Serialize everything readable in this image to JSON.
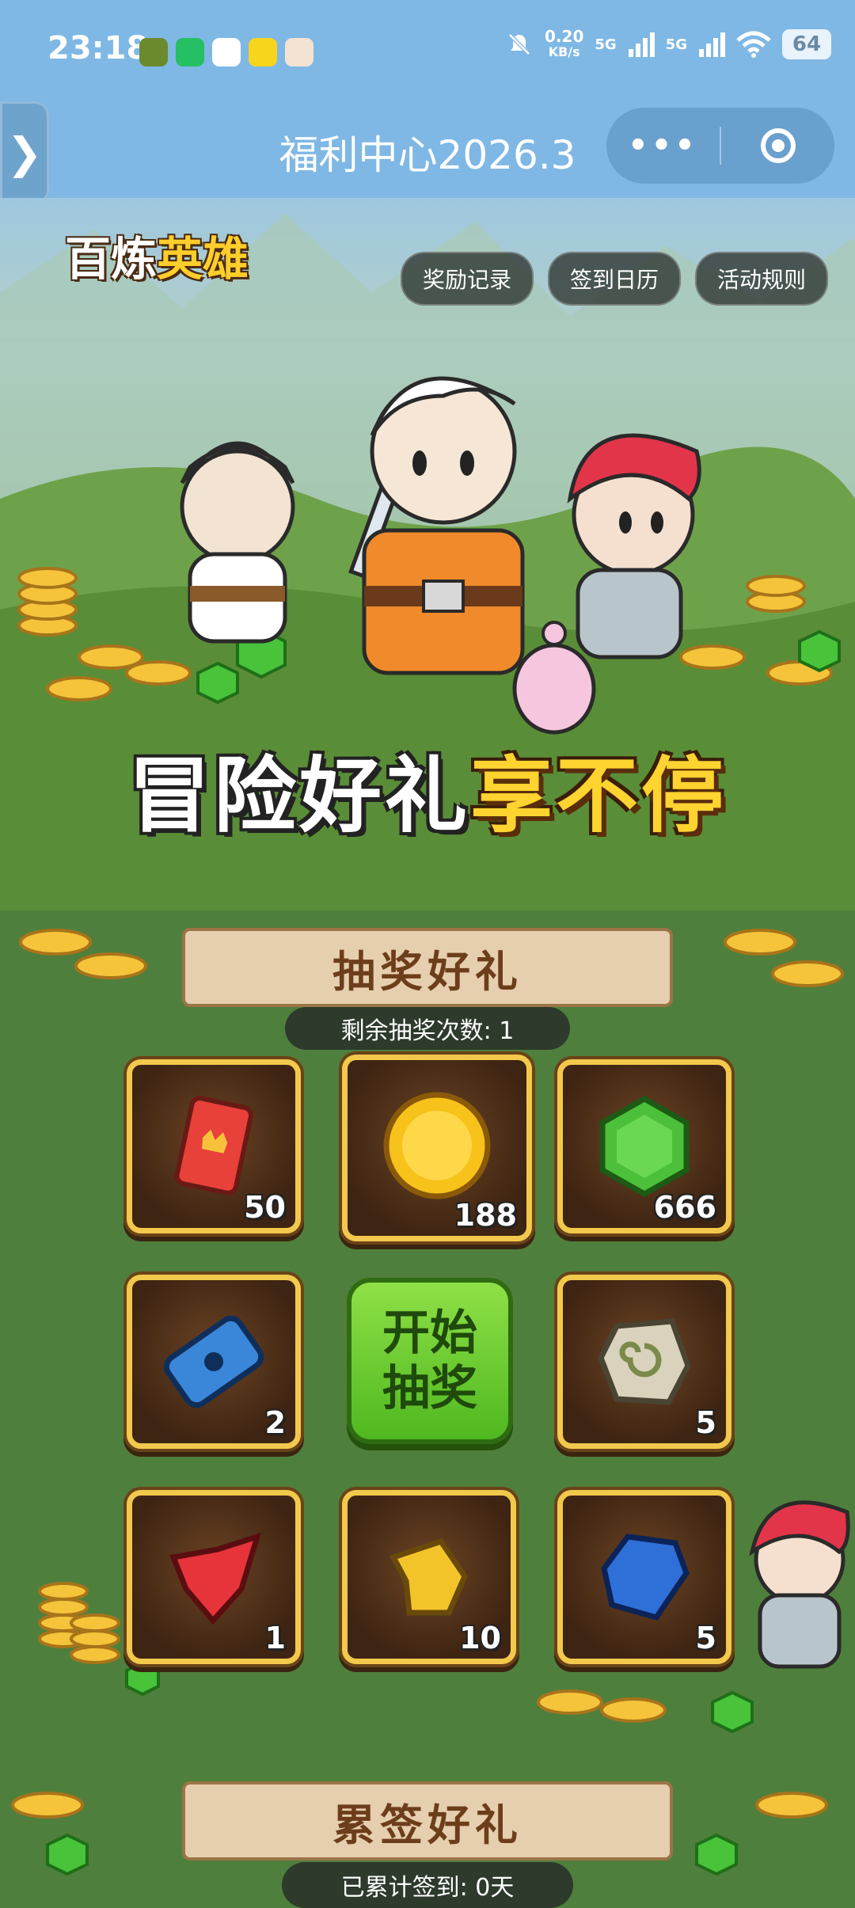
{
  "status_bar": {
    "time": "23:18",
    "net_speed_value": "0.20",
    "net_speed_unit": "KB/s",
    "signal1": "5G",
    "signal2": "5G",
    "battery": "64"
  },
  "title_bar": {
    "title": "福利中心2026.3",
    "more": "•••"
  },
  "hero": {
    "logo_part1": "百炼",
    "logo_part2": "英雄",
    "links": [
      "奖励记录",
      "签到日历",
      "活动规则"
    ],
    "slogan_white": "冒险好礼",
    "slogan_yellow": "享不停"
  },
  "lottery": {
    "heading": "抽奖好礼",
    "remaining": "剩余抽奖次数: 1",
    "start_line1": "开始",
    "start_line2": "抽奖",
    "prizes": [
      {
        "icon": "red-card-icon",
        "qty": "50"
      },
      {
        "icon": "gold-coin-icon",
        "qty": "188"
      },
      {
        "icon": "green-gem-icon",
        "qty": "666"
      },
      {
        "icon": "blue-ticket-icon",
        "qty": "2"
      },
      {
        "icon": "stone-rune-icon",
        "qty": "5"
      },
      {
        "icon": "red-crystal-icon",
        "qty": "1"
      },
      {
        "icon": "yellow-crystal-icon",
        "qty": "10"
      },
      {
        "icon": "blue-crystal-icon",
        "qty": "5"
      }
    ]
  },
  "signin": {
    "heading": "累签好礼",
    "total": "已累计签到: 0天"
  },
  "colors": {
    "header_blue": "#7fb8e4",
    "grass_green": "#4f7f3c",
    "frame_gold": "#f2c94c",
    "start_green": "#5cc026"
  }
}
